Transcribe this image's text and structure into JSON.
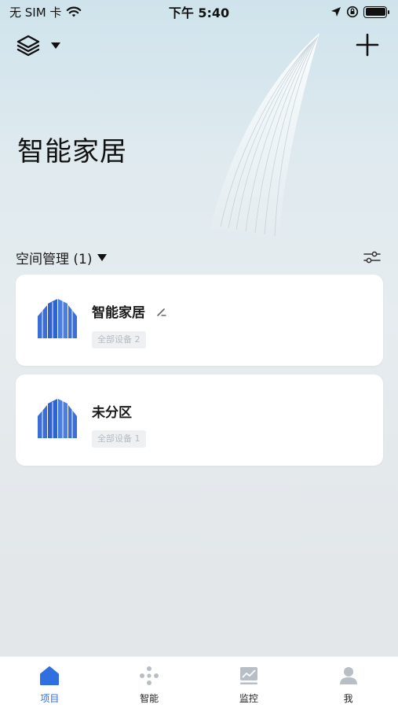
{
  "status_bar": {
    "carrier": "无 SIM 卡",
    "time": "下午 5:40"
  },
  "header": {
    "title": "智能家居"
  },
  "spaces": {
    "title": "空间管理 (1)",
    "items": [
      {
        "name": "智能家居",
        "badge": "全部设备 2"
      },
      {
        "name": "未分区",
        "badge": "全部设备 1"
      }
    ]
  },
  "tab_bar": {
    "tabs": [
      {
        "label": "项目",
        "icon": "home-icon",
        "active": true
      },
      {
        "label": "智能",
        "icon": "automation-icon",
        "active": false
      },
      {
        "label": "监控",
        "icon": "chart-icon",
        "active": false
      },
      {
        "label": "我",
        "icon": "user-icon",
        "active": false
      }
    ]
  },
  "colors": {
    "accent": "#2f6fe0",
    "building": "#3b6fd6"
  }
}
